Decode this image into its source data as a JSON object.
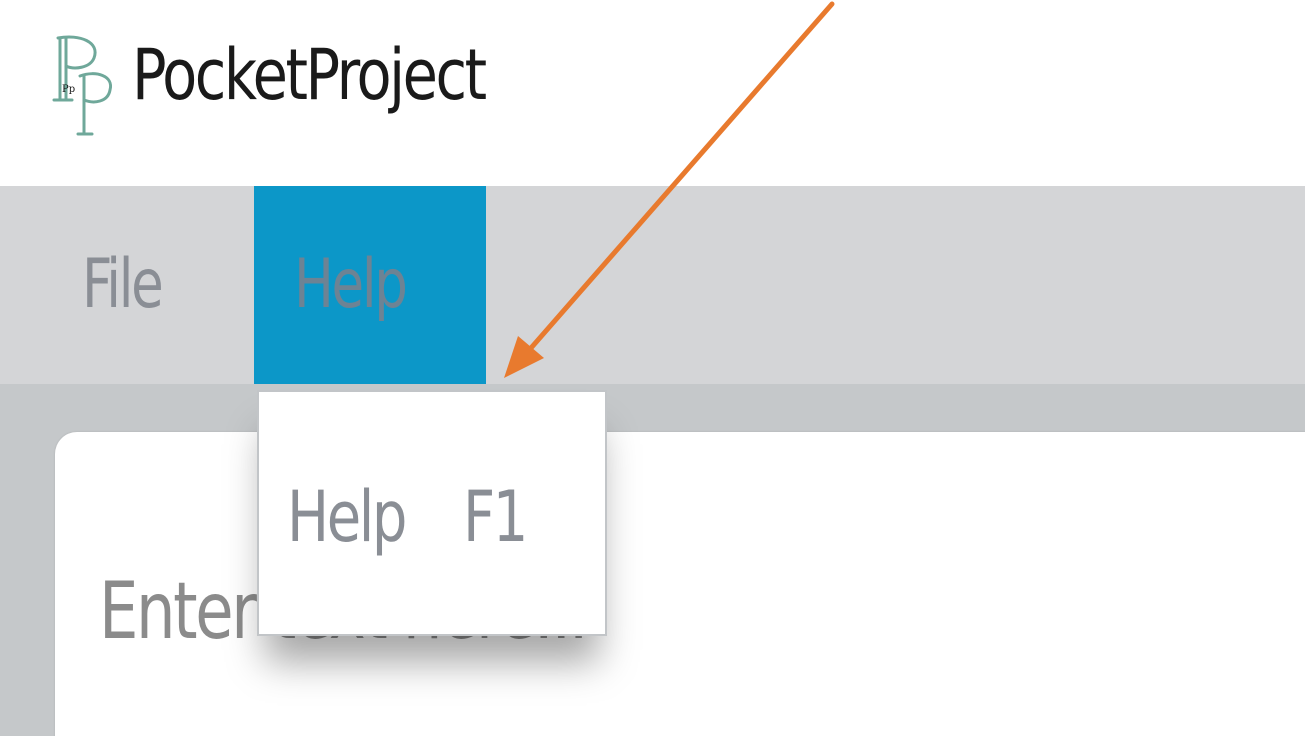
{
  "app": {
    "title": "PocketProject",
    "logo_text": "Pp"
  },
  "menubar": {
    "items": [
      {
        "label": "File",
        "active": false
      },
      {
        "label": "Help",
        "active": true
      }
    ]
  },
  "dropdown": {
    "items": [
      {
        "label": "Help",
        "shortcut": "F1"
      }
    ]
  },
  "editor": {
    "placeholder": "Enter text here..."
  },
  "colors": {
    "menu_bar_bg": "#d4d5d7",
    "menu_active_bg": "#0c97c8",
    "content_bg": "#c5c8ca",
    "logo_color": "#6fa89a",
    "annotation_arrow": "#e87a2e"
  },
  "icons": {
    "logo": "pocketproject-logo-icon",
    "annotation": "annotation-arrow-icon"
  }
}
